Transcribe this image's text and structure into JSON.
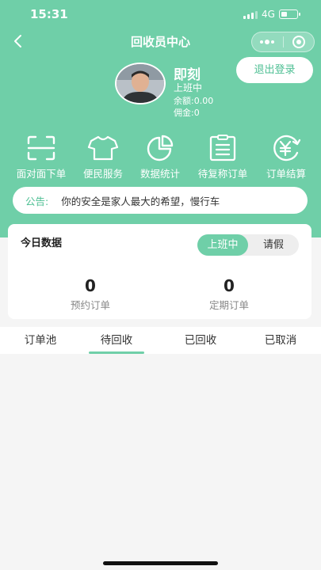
{
  "status_bar": {
    "time": "15:31",
    "network": "4G"
  },
  "nav": {
    "title": "回收员中心"
  },
  "user": {
    "name": "即刻",
    "status": "上班中",
    "balance": "余额:0.00",
    "commission": "佣金:0"
  },
  "logout_label": "退出登录",
  "quick_menu": [
    {
      "label": "面对面下单",
      "icon": "scan-icon"
    },
    {
      "label": "便民服务",
      "icon": "shirt-icon"
    },
    {
      "label": "数据统计",
      "icon": "pie-chart-icon"
    },
    {
      "label": "待复称订单",
      "icon": "clipboard-list-icon"
    },
    {
      "label": "订单结算",
      "icon": "yen-cycle-icon"
    }
  ],
  "notice": {
    "label": "公告:",
    "text": "你的安全是家人最大的希望，慢行车"
  },
  "today": {
    "title": "今日数据",
    "toggle": [
      "上班中",
      "请假"
    ],
    "stats": [
      {
        "value": "0",
        "label": "预约订单"
      },
      {
        "value": "0",
        "label": "定期订单"
      }
    ]
  },
  "tabs": [
    "订单池",
    "待回收",
    "已回收",
    "已取消"
  ],
  "colors": {
    "accent": "#6fcfa8",
    "accent_text": "#4dbf93"
  }
}
